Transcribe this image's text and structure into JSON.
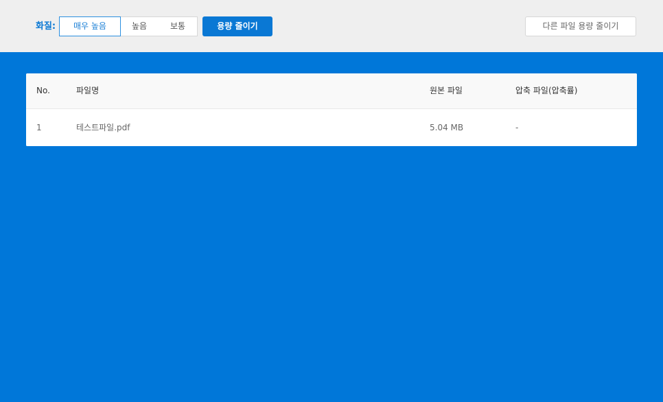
{
  "toolbar": {
    "quality_label": "화질:",
    "quality_options": [
      "매우 높음",
      "높음",
      "보통"
    ],
    "selected_quality": "매우 높음",
    "reduce_button": "용량 줄이기",
    "other_file_button": "다른 파일 용량 줄이기"
  },
  "table": {
    "headers": {
      "no": "No.",
      "filename": "파일명",
      "original": "원본 파일",
      "compressed": "압축 파일(압축률)"
    },
    "rows": [
      {
        "no": "1",
        "filename": "테스트파일.pdf",
        "original": "5.04 MB",
        "compressed": "-"
      }
    ]
  },
  "colors": {
    "background": "#0077d9",
    "toolbar": "#efefef",
    "accent": "#0a78d4"
  }
}
